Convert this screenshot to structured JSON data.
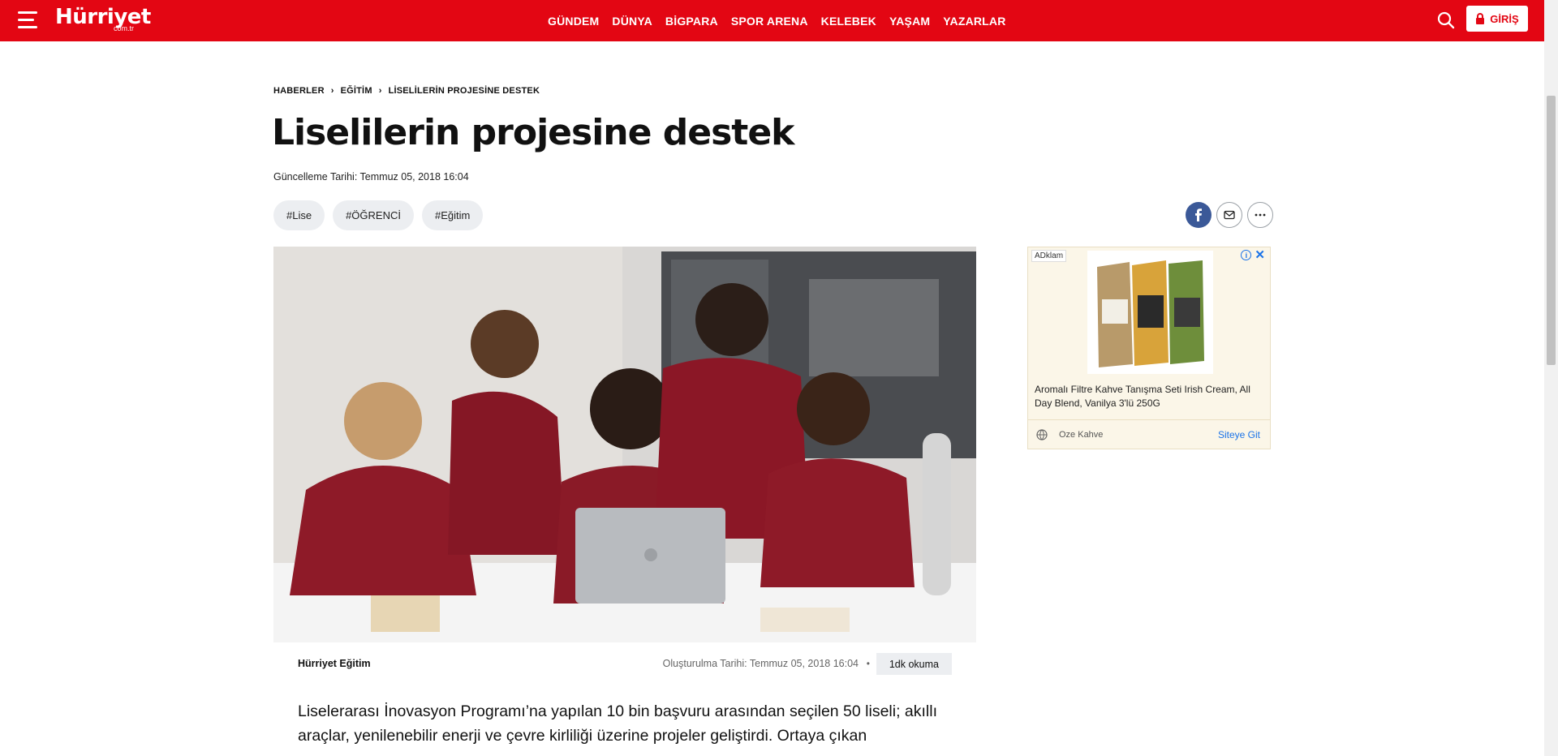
{
  "header": {
    "logo": "Hürriyet",
    "logo_sub": "com.tr",
    "nav": [
      "GÜNDEM",
      "DÜNYA",
      "BİGPARA",
      "SPOR ARENA",
      "KELEBEK",
      "YAŞAM",
      "YAZARLAR"
    ],
    "login_label": "GİRİŞ",
    "colors": {
      "brand": "#e30613"
    }
  },
  "breadcrumb": [
    "HABERLER",
    "EĞİTİM",
    "LİSELİLERİN PROJESİNE DESTEK"
  ],
  "article": {
    "title": "Liselilerin projesine destek",
    "updated": "Güncelleme Tarihi: Temmuz 05, 2018 16:04",
    "tags": [
      "#Lise",
      "#ÖĞRENCİ",
      "#Eğitim"
    ],
    "author": "Hürriyet Eğitim",
    "created": "Oluşturulma Tarihi: Temmuz 05, 2018 16:04",
    "separator": "•",
    "read_time": "1dk okuma",
    "lead": "Liselerarası İnovasyon Programı’na yapılan 10 bin başvuru arasından seçilen 50 liseli; akıllı araçlar, yenilenebilir enerji ve çevre kirliliği üzerine projeler geliştirdi. Ortaya çıkan"
  },
  "share": {
    "icons": [
      "facebook-icon",
      "mail-icon",
      "more-icon"
    ]
  },
  "ad": {
    "label": "AD",
    "label_extra": "klam",
    "description": "Aromalı Filtre Kahve Tanışma Seti Irish Cream, All Day Blend, Vanilya 3'lü 250G",
    "brand": "Oze Kahve",
    "cta": "Siteye Git"
  }
}
